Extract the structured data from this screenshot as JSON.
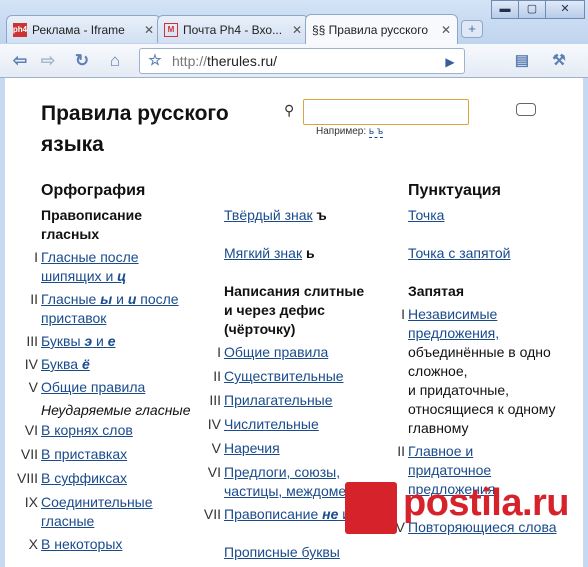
{
  "browser": {
    "tabs": [
      {
        "label": "Реклама - Iframe",
        "favicon": "рh4"
      },
      {
        "label": "Почта Ph4 - Вхо...",
        "favicon": "M"
      },
      {
        "label": "§§ Правила русского"
      }
    ],
    "new_tab": "+",
    "url_proto": "http://",
    "url_host": "therules.ru/"
  },
  "site": {
    "title": "Правила русского языка",
    "search_placeholder": "",
    "example_label": "Например:",
    "example_value": "ь ъ"
  },
  "col1": {
    "heading": "Орфография",
    "subheading": "Правописание гласных",
    "items": [
      {
        "num": "I",
        "a": "Гласные после шипящих и ",
        "b": "ц"
      },
      {
        "num": "II",
        "a": "Гласные ",
        "b": "ы",
        "c": " и ",
        "d": "и",
        "e": " после приставок"
      },
      {
        "num": "III",
        "a": "Буквы ",
        "b": "э",
        "c": " и ",
        "d": "е"
      },
      {
        "num": "IV",
        "a": "Буква ",
        "b": "ё"
      },
      {
        "num": "V",
        "a": "Общие правила"
      }
    ],
    "unstressed_label": "Неударяемые гласные",
    "items2": [
      {
        "num": "VI",
        "a": "В корнях слов"
      },
      {
        "num": "VII",
        "a": "В приставках"
      },
      {
        "num": "VIII",
        "a": "В суффиксах"
      },
      {
        "num": "IX",
        "a": "Соединительные гласные"
      },
      {
        "num": "X",
        "a": "В некоторых"
      }
    ]
  },
  "col2": {
    "hard_sign": "Твёрдый знак",
    "hard_sign_glyph": "ъ",
    "soft_sign": "Мягкий знак",
    "soft_sign_glyph": "ь",
    "subheading": "Написания слитные и через дефис (чёрточку)",
    "items": [
      {
        "num": "I",
        "a": "Общие правила"
      },
      {
        "num": "II",
        "a": "Существительные"
      },
      {
        "num": "III",
        "a": "Прилагательные"
      },
      {
        "num": "IV",
        "a": "Числительные"
      },
      {
        "num": "V",
        "a": "Наречия"
      },
      {
        "num": "VI",
        "a": "Предлоги, союзы, частицы, междометия"
      },
      {
        "num": "VII",
        "a": "Правописание ",
        "b": "не",
        "c": " и ",
        "d": "ни"
      }
    ],
    "capital_letters": "Прописные буквы"
  },
  "col3": {
    "heading": "Пунктуация",
    "dot": "Точка",
    "semicolon": "Точка с запятой",
    "comma_heading": "Запятая",
    "items": [
      {
        "num": "I",
        "link": "Независимые предложения,",
        "rest": "объединённые в одно сложное,",
        "link2": "",
        "rest2": "и придаточные, относящиеся к одному главному"
      },
      {
        "num": "II",
        "link": "Главное и придаточное предложения"
      },
      {
        "num": "IV",
        "link": "Повторяющиеся слова"
      }
    ]
  },
  "watermark": {
    "text": "postila.ru"
  },
  "colors": {
    "link": "#1a4b8c",
    "search_border": "#d9a53d",
    "watermark": "#d6232b"
  }
}
